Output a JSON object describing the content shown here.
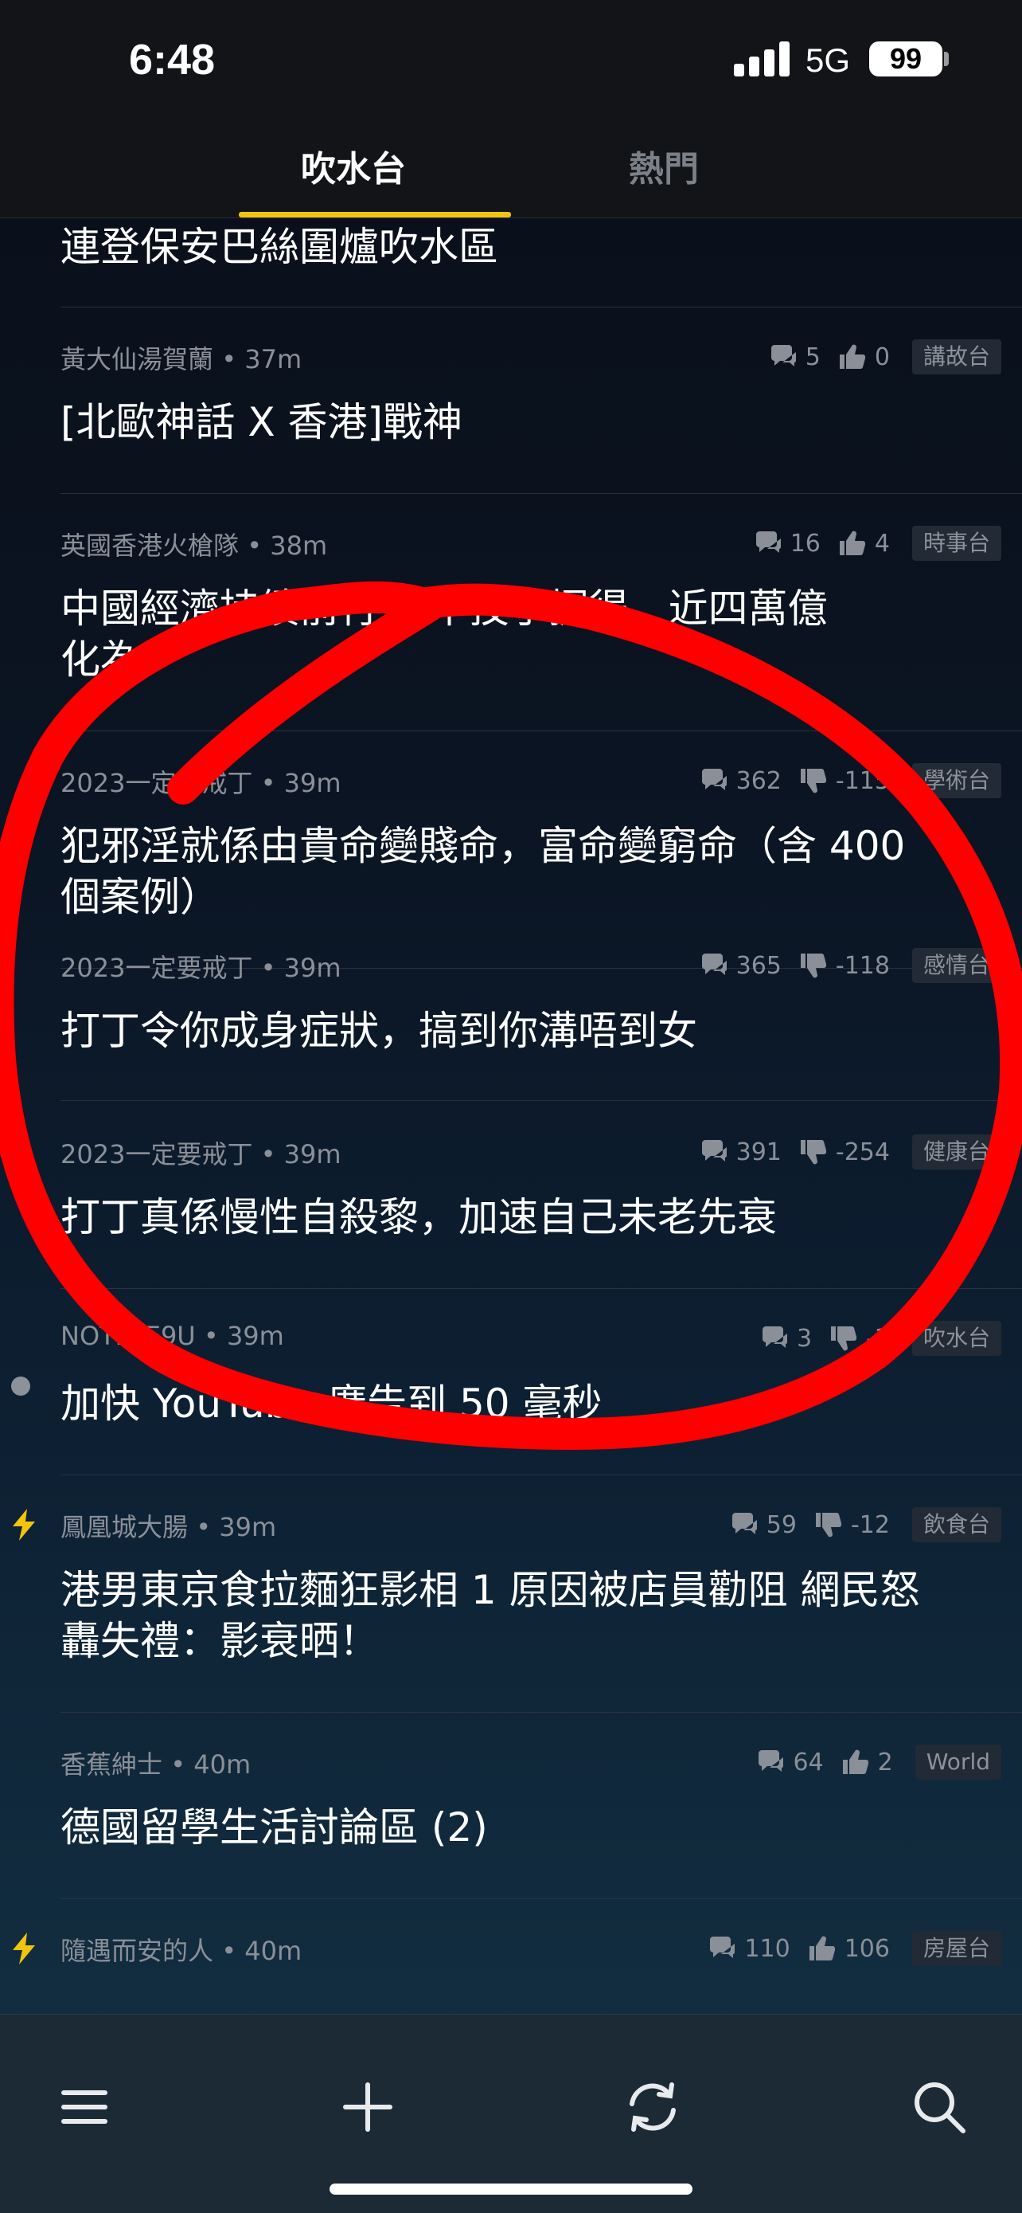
{
  "status_bar": {
    "time": "6:48",
    "network": "5G",
    "battery": "99"
  },
  "tabs": [
    {
      "label": "吹水台",
      "active": true
    },
    {
      "label": "熱門",
      "active": false
    }
  ],
  "top_partial_title": "連登保安巴絲圍爐吹水區",
  "posts": [
    {
      "author": "黃大仙湯賀蘭",
      "time": "37m",
      "replies": "5",
      "vote_type": "up",
      "votes": "0",
      "channel": "講故台",
      "title": "[北歐神話 X 香港]戰神",
      "side": ""
    },
    {
      "author": "英國香港火槍隊",
      "time": "38m",
      "replies": "16",
      "vote_type": "up",
      "votes": "4",
      "channel": "時事台",
      "title": "中國經濟持續前行 3 中技手掘得，近四萬億\n化為！",
      "side": ""
    },
    {
      "author": "2023一定要戒丁",
      "time": "39m",
      "replies": "362",
      "vote_type": "down",
      "votes": "-115",
      "channel": "學術台",
      "title": "犯邪淫就係由貴命變賤命，富命變窮命（含 400\n個案例）",
      "side": ""
    },
    {
      "author": "2023一定要戒丁",
      "time": "39m",
      "replies": "365",
      "vote_type": "down",
      "votes": "-118",
      "channel": "感情台",
      "title": "打丁令你成身症狀，搞到你溝唔到女",
      "side": ""
    },
    {
      "author": "2023一定要戒丁",
      "time": "39m",
      "replies": "391",
      "vote_type": "down",
      "votes": "-254",
      "channel": "健康台",
      "title": "打丁真係慢性自殺黎，加速自己未老先衰",
      "side": ""
    },
    {
      "author": "NOTIME9U",
      "time": "39m",
      "replies": "3",
      "vote_type": "down",
      "votes": "-3",
      "channel": "吹水台",
      "title": "加快 YouTube 廣告到 50 毫秒",
      "side": "dot"
    },
    {
      "author": "鳳凰城大腸",
      "time": "39m",
      "replies": "59",
      "vote_type": "down",
      "votes": "-12",
      "channel": "飲食台",
      "title": "港男東京食拉麵狂影相 1 原因被店員勸阻 網民怒\n轟失禮：影衰晒！",
      "side": "bolt"
    },
    {
      "author": "香蕉紳士",
      "time": "40m",
      "replies": "64",
      "vote_type": "up",
      "votes": "2",
      "channel": "World",
      "title": "德國留學生活討論區 (2)",
      "side": ""
    },
    {
      "author": "隨遇而安的人",
      "time": "40m",
      "replies": "110",
      "vote_type": "up",
      "votes": "106",
      "channel": "房屋台",
      "title": "",
      "side": "bolt"
    }
  ],
  "bottom_bar": {
    "menu_icon": "menu-icon",
    "add_icon": "plus-icon",
    "refresh_icon": "refresh-icon",
    "search_icon": "search-icon"
  },
  "annotation_color": "#ff0000"
}
